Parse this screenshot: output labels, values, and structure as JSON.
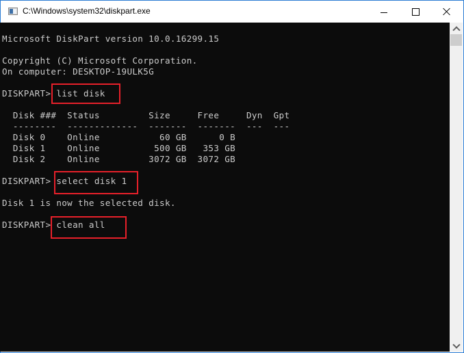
{
  "window": {
    "title": "C:\\Windows\\system32\\diskpart.exe",
    "icon": "console-app-icon",
    "controls": {
      "minimize": "minimize-icon",
      "maximize": "maximize-icon",
      "close": "close-icon"
    }
  },
  "console": {
    "lines": [
      "Microsoft DiskPart version 10.0.16299.15",
      "",
      "Copyright (C) Microsoft Corporation.",
      "On computer: DESKTOP-19ULK5G",
      "",
      "DISKPART> list disk",
      "",
      "  Disk ###  Status         Size     Free     Dyn  Gpt",
      "  --------  -------------  -------  -------  ---  ---",
      "  Disk 0    Online           60 GB      0 B",
      "  Disk 1    Online          500 GB   353 GB",
      "  Disk 2    Online         3072 GB  3072 GB",
      "",
      "DISKPART> select disk 1",
      "",
      "Disk 1 is now the selected disk.",
      "",
      "DISKPART> clean all"
    ],
    "prompt": "DISKPART>",
    "commands": [
      "list disk",
      "select disk 1",
      "clean all"
    ],
    "disk_table": {
      "columns": [
        "Disk ###",
        "Status",
        "Size",
        "Free",
        "Dyn",
        "Gpt"
      ],
      "rows": [
        [
          "Disk 0",
          "Online",
          "60 GB",
          "0 B",
          "",
          ""
        ],
        [
          "Disk 1",
          "Online",
          "500 GB",
          "353 GB",
          "",
          ""
        ],
        [
          "Disk 2",
          "Online",
          "3072 GB",
          "3072 GB",
          "",
          ""
        ]
      ]
    },
    "highlight_color": "#e8202a",
    "text_color": "#cccccc",
    "background_color": "#0c0c0c"
  },
  "scrollbar": {
    "up": "chevron-up-icon",
    "down": "chevron-down-icon"
  }
}
